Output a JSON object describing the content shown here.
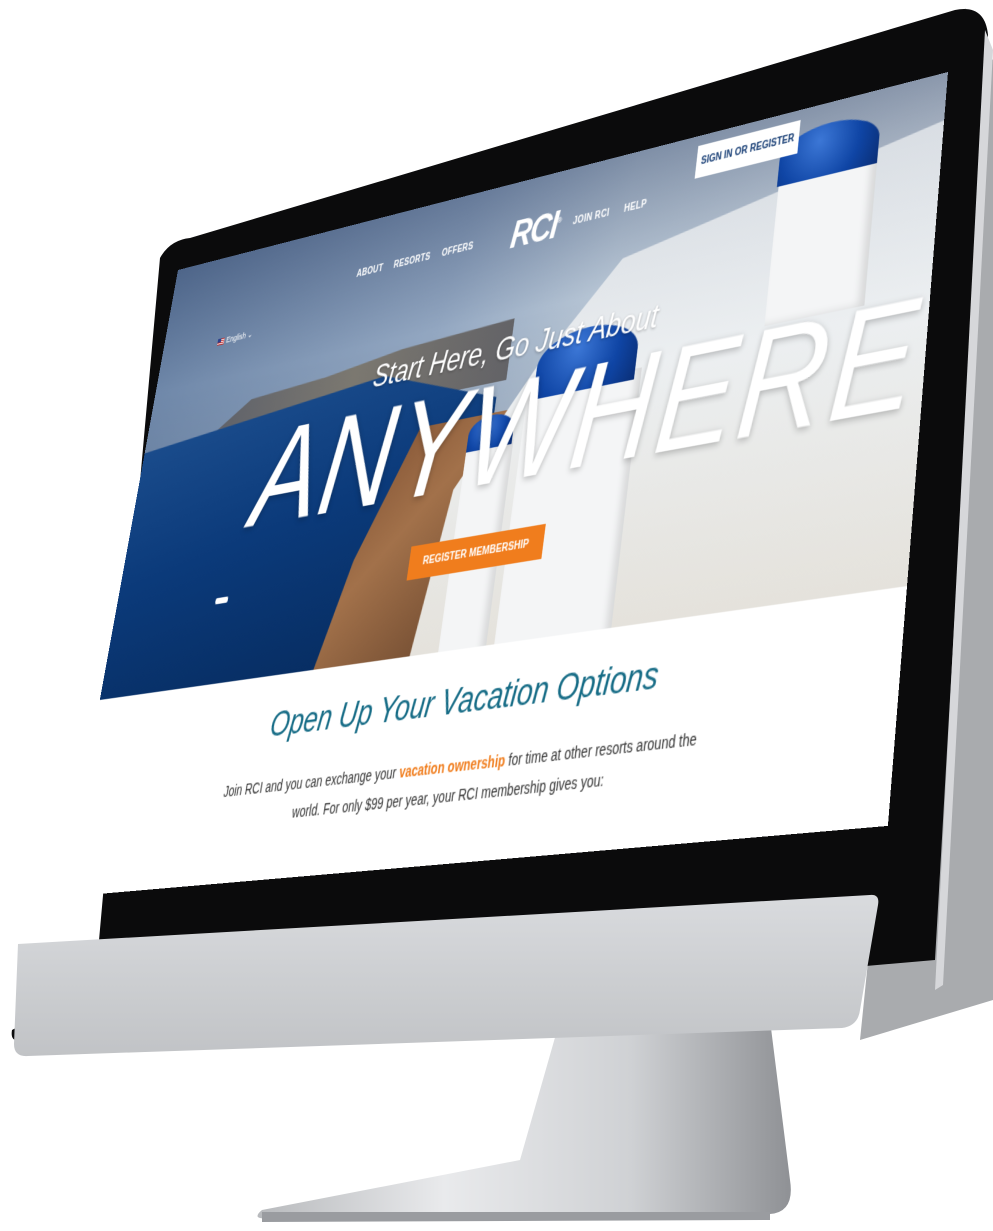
{
  "header": {
    "language": "English",
    "nav_left": [
      "ABOUT",
      "RESORTS",
      "OFFERS"
    ],
    "logo": "RCI",
    "logo_mark": "®",
    "nav_right": [
      "JOIN RCI",
      "HELP"
    ],
    "signin_label": "SIGN IN OR REGISTER"
  },
  "hero": {
    "tagline": "Start Here, Go Just About",
    "headline": "ANYWHERE",
    "cta_label": "REGISTER MEMBERSHIP"
  },
  "content": {
    "title": "Open Up Your Vacation Options",
    "intro_before": "Join RCI and you can exchange your ",
    "intro_link": "vacation ownership",
    "intro_after": " for time at other resorts around the world. For only $99 per year, your RCI membership gives you:"
  },
  "colors": {
    "accent": "#f07d1d",
    "brand_blue": "#143b73",
    "title_teal": "#166c86"
  }
}
